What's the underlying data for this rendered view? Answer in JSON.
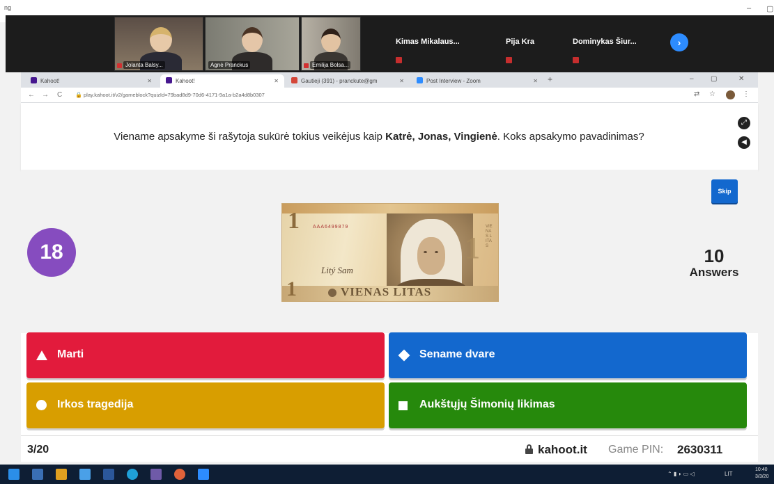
{
  "zoom": {
    "app_label": "ng",
    "participants_video": [
      {
        "name": "Jolanta Balsy..."
      },
      {
        "name": "Agnė Pranckus"
      },
      {
        "name": "Emilija Bolsa..."
      }
    ],
    "participants_named": [
      {
        "name": "Kimas  Mikalaus..."
      },
      {
        "name": "Pija Kra"
      },
      {
        "name": "Dominykas Šiur..."
      }
    ],
    "next_icon": "chevron-right-icon"
  },
  "browser": {
    "tabs": [
      {
        "title": "Kahoot!",
        "active": false
      },
      {
        "title": "Kahoot!",
        "active": true
      },
      {
        "title": "Gautieji (391) - pranckute@gm",
        "active": false
      },
      {
        "title": "Post Interview - Zoom",
        "active": false
      }
    ],
    "url": "play.kahoot.it/v2/gameblock?quizId=79bad8d9-70d6-4171-9a1a-b2a4d8b0307",
    "controls": {
      "minimize": "–",
      "maximize": "▢",
      "close": "✕"
    }
  },
  "question": {
    "text_before": "Viename apsakyme ši rašytoja sukūrė tokius veikėjus kaip ",
    "text_bold": "Katrė, Jonas, Vingienė",
    "text_after": ". Koks apsakymo pavadinimas?",
    "skip_label": "Skip",
    "timer": "18",
    "answers_count": "10",
    "answers_label": "Answers",
    "image": {
      "denomination": "1",
      "serial": "AAA6499879",
      "signature": "Litý Sam",
      "banner_text": "VIENAS LITAS"
    }
  },
  "answers": [
    {
      "shape": "triangle-icon",
      "label": "Marti",
      "color": "#e21b3c"
    },
    {
      "shape": "diamond-icon",
      "label": "Sename dvare",
      "color": "#1368ce"
    },
    {
      "shape": "circle-icon",
      "label": "Irkos tragedija",
      "color": "#d89e00"
    },
    {
      "shape": "square-icon",
      "label": "Aukštųjų Šimonių likimas",
      "color": "#26890c"
    }
  ],
  "footer": {
    "progress": "3/20",
    "site": "kahoot.it",
    "pin_label": "Game PIN:",
    "pin": "2630311"
  },
  "taskbar": {
    "lang": "LIT",
    "time": "10:40",
    "date": "3/3/20"
  }
}
